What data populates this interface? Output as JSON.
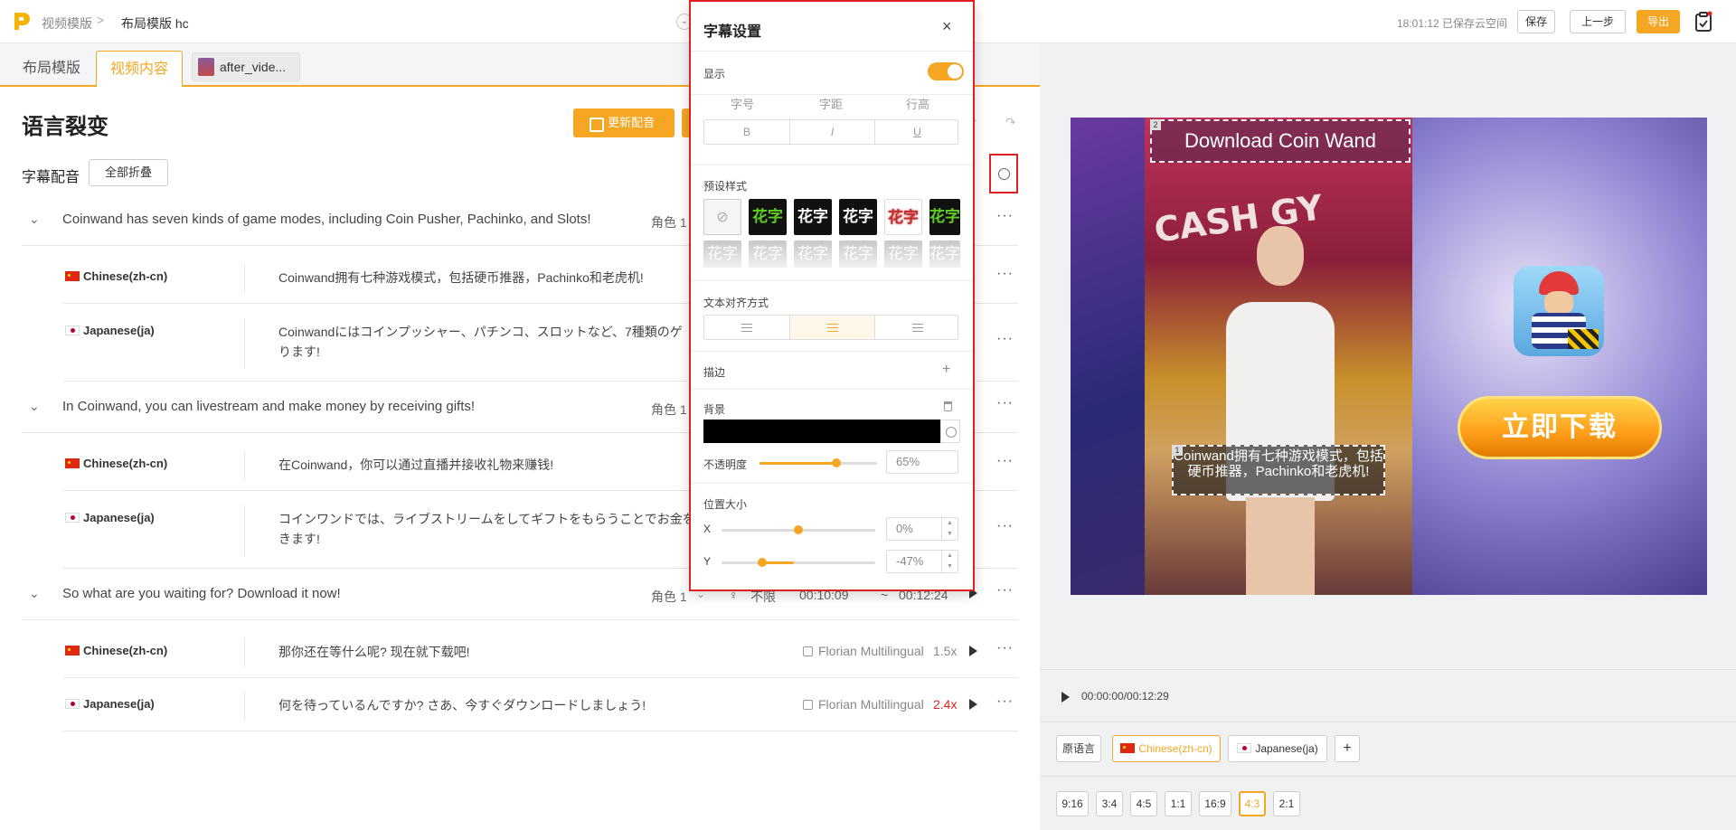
{
  "header": {
    "crumb_root": "视频模版",
    "crumb_sep": ">",
    "crumb_current": "布局模版  hc",
    "save_status": "18:01:12 已保存云空间",
    "save_label": "保存",
    "prev_label": "上一步",
    "export_label": "导出"
  },
  "tabs": {
    "layout": "布局模版",
    "video": "视频内容",
    "file": "after_vide..."
  },
  "content": {
    "title": "语言裂变",
    "update_voice": "更新配音",
    "subtitle_section": "字幕配音",
    "collapse_all": "全部折叠"
  },
  "segments": [
    {
      "text": "Coinwand has seven kinds of game modes, including Coin Pusher, Pachinko, and Slots!",
      "role": "角色 1",
      "translations": [
        {
          "lang": "Chinese(zh-cn)",
          "text": "Coinwand拥有七种游戏模式，包括硬币推器，Pachinko和老虎机!"
        },
        {
          "lang": "Japanese(ja)",
          "text": "Coinwandにはコインプッシャー、パチンコ、スロットなど、7種類のゲ",
          "text2": "ります!"
        }
      ]
    },
    {
      "text": "In Coinwand, you can livestream and make money by receiving gifts!",
      "role": "角色 1",
      "translations": [
        {
          "lang": "Chinese(zh-cn)",
          "text": "在Coinwand，你可以通过直播并接收礼物来赚钱!"
        },
        {
          "lang": "Japanese(ja)",
          "text": "コインワンドでは、ライブストリームをしてギフトをもらうことでお金を",
          "text2": "きます!"
        }
      ]
    },
    {
      "text": "So what are you waiting for? Download it now!",
      "role": "角色 1",
      "gender": "♀",
      "unlimited": "不限",
      "start": "00:10:09",
      "tilde": "~",
      "end": "00:12:24",
      "translations": [
        {
          "lang": "Chinese(zh-cn)",
          "text": "那你还在等什么呢? 现在就下载吧!",
          "voice": "Florian Multilingual",
          "speed": "1.5x"
        },
        {
          "lang": "Japanese(ja)",
          "text": "何を待っているんですか? さあ、今すぐダウンロードしましょう!",
          "voice": "Florian Multilingual",
          "speed": "2.4x"
        }
      ]
    }
  ],
  "modal": {
    "title": "字幕设置",
    "close": "×",
    "display_label": "显示",
    "display_on": true,
    "font_size_label": "字号",
    "spacing_label": "字距",
    "line_height_label": "行高",
    "bold": "B",
    "italic": "I",
    "underline": "U",
    "preset_label": "预设样式",
    "preset_none": "⊘",
    "preset_sample": "花字",
    "align_label": "文本对齐方式",
    "stroke_label": "描边",
    "stroke_add": "+",
    "bg_label": "背景",
    "bg_color": "#000000",
    "opacity_label": "不透明度",
    "opacity_value": "65%",
    "opacity_level": 0.65,
    "position_label": "位置大小",
    "x_label": "X",
    "x_value": "0%",
    "y_label": "Y",
    "y_value": "-47%"
  },
  "preview": {
    "title_overlay": "Download Coin Wand",
    "title_badge": "2",
    "subtitle_overlay": "Coinwand拥有七种游戏模式，包括硬币推器，Pachinko和老虎机!",
    "subtitle_badge": "1",
    "cash_text": "CASH  GY",
    "download_cta": "立即下载"
  },
  "player": {
    "time": "00:00:00/00:12:29"
  },
  "languages": [
    "原语言",
    "Chinese(zh-cn)",
    "Japanese(ja)",
    "+"
  ],
  "ratios": [
    "9:16",
    "3:4",
    "4:5",
    "1:1",
    "16:9",
    "4:3",
    "2:1"
  ],
  "colors": {
    "accent": "#f5a623",
    "highlight_border": "#e02020",
    "speed_warning": "#e02020"
  }
}
